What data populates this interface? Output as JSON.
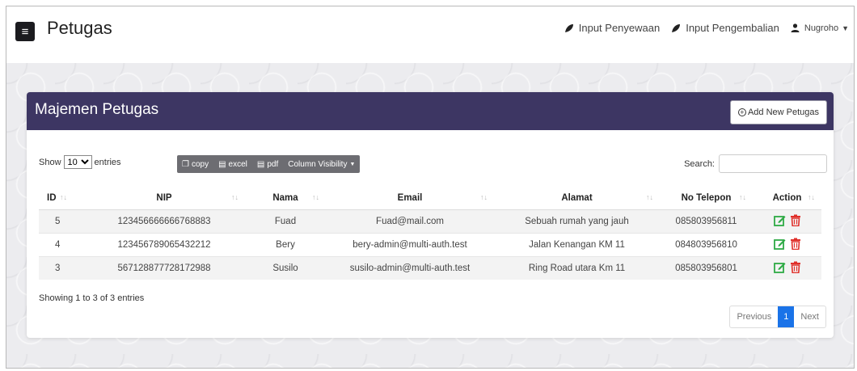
{
  "navbar": {
    "menu_icon": "hamburger-icon",
    "brand": "Petugas",
    "links": [
      {
        "label": "Input Penyewaan",
        "icon": "leaf-icon"
      },
      {
        "label": "Input Pengembalian",
        "icon": "leaf-icon"
      }
    ],
    "user": {
      "label": "Nugroho",
      "icon": "user-icon"
    }
  },
  "card": {
    "title": "Majemen Petugas",
    "add_button": "Add New Petugas",
    "header_color": "#3d3663"
  },
  "controls": {
    "show_label": "Show",
    "entries_value": "10",
    "entries_label": "entries",
    "buttons": [
      "copy",
      "excel",
      "pdf",
      "Column Visibility"
    ],
    "search_label": "Search:",
    "search_value": ""
  },
  "table": {
    "headers": [
      "ID",
      "NIP",
      "Nama",
      "Email",
      "Alamat",
      "No Telepon",
      "Action"
    ],
    "rows": [
      [
        "5",
        "123456666666768883",
        "Fuad",
        "Fuad@mail.com",
        "Sebuah rumah yang jauh",
        "085803956811"
      ],
      [
        "4",
        "123456789065432212",
        "Bery",
        "bery-admin@multi-auth.test",
        "Jalan Kenangan KM 11",
        "084803956810"
      ],
      [
        "3",
        "567128877728172988",
        "Susilo",
        "susilo-admin@multi-auth.test",
        "Ring Road utara Km 11",
        "085803956801"
      ]
    ],
    "edit_color": "#2eaa45",
    "delete_color": "#e0302b"
  },
  "footer": {
    "info": "Showing 1 to 3 of 3 entries",
    "pagination": {
      "previous": "Previous",
      "current": "1",
      "next": "Next"
    },
    "active_color": "#1a73e8"
  }
}
